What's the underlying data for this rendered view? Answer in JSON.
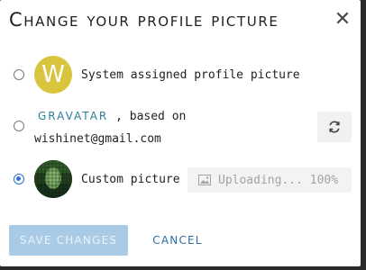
{
  "dialog": {
    "title": "Change your profile picture",
    "close_icon": "close-icon"
  },
  "options": {
    "system": {
      "avatar_letter": "W",
      "label": "System assigned profile picture",
      "avatar_color": "#d9c43d"
    },
    "gravatar": {
      "link": "GRAVATAR",
      "suffix": ", based on",
      "email": "wishinet@gmail.com",
      "refresh_icon": "refresh-icon"
    },
    "custom": {
      "label": "Custom picture",
      "upload_icon": "image-icon",
      "upload_status": "Uploading... 100%",
      "selected": true
    }
  },
  "footer": {
    "save_label": "SAVE CHANGES",
    "cancel_label": "CANCEL"
  },
  "colors": {
    "accent": "#2e6ea5",
    "save_disabled": "#a9cbe6",
    "link": "#2e7f9a"
  }
}
